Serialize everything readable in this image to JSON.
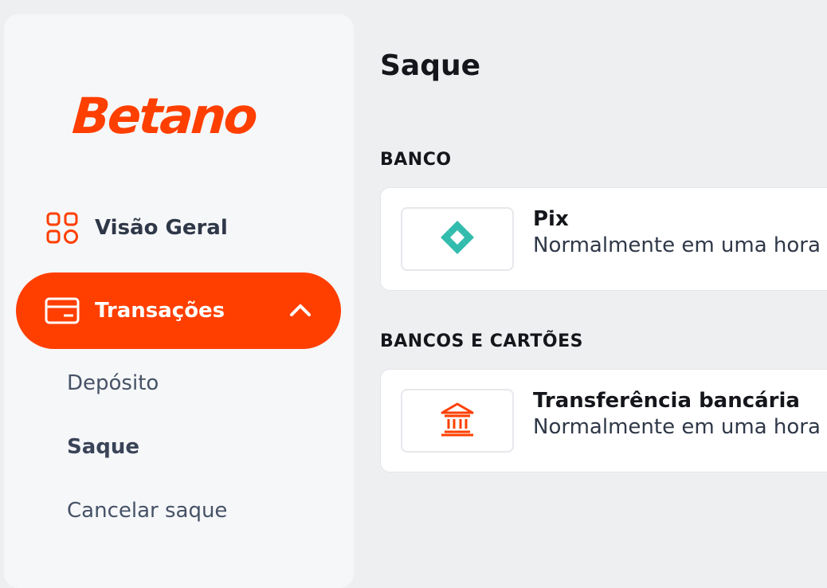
{
  "brand": {
    "name": "Betano",
    "color": "#ff3f00"
  },
  "sidebar": {
    "items": [
      {
        "label": "Visão Geral",
        "icon": "grid-icon"
      },
      {
        "label": "Transações",
        "icon": "credit-card-icon",
        "expanded": true
      }
    ],
    "subitems": [
      {
        "label": "Depósito"
      },
      {
        "label": "Saque",
        "active": true
      },
      {
        "label": "Cancelar saque"
      }
    ]
  },
  "main": {
    "title": "Saque",
    "sections": [
      {
        "title": "BANCO",
        "methods": [
          {
            "name": "Pix",
            "description": "Normalmente em uma hora",
            "icon": "pix-icon",
            "color": "#32bcad"
          }
        ]
      },
      {
        "title": "BANCOS E CARTÕES",
        "methods": [
          {
            "name": "Transferência bancária",
            "description": "Normalmente em uma hora",
            "icon": "bank-icon",
            "color": "#ff3f00"
          }
        ]
      }
    ]
  }
}
